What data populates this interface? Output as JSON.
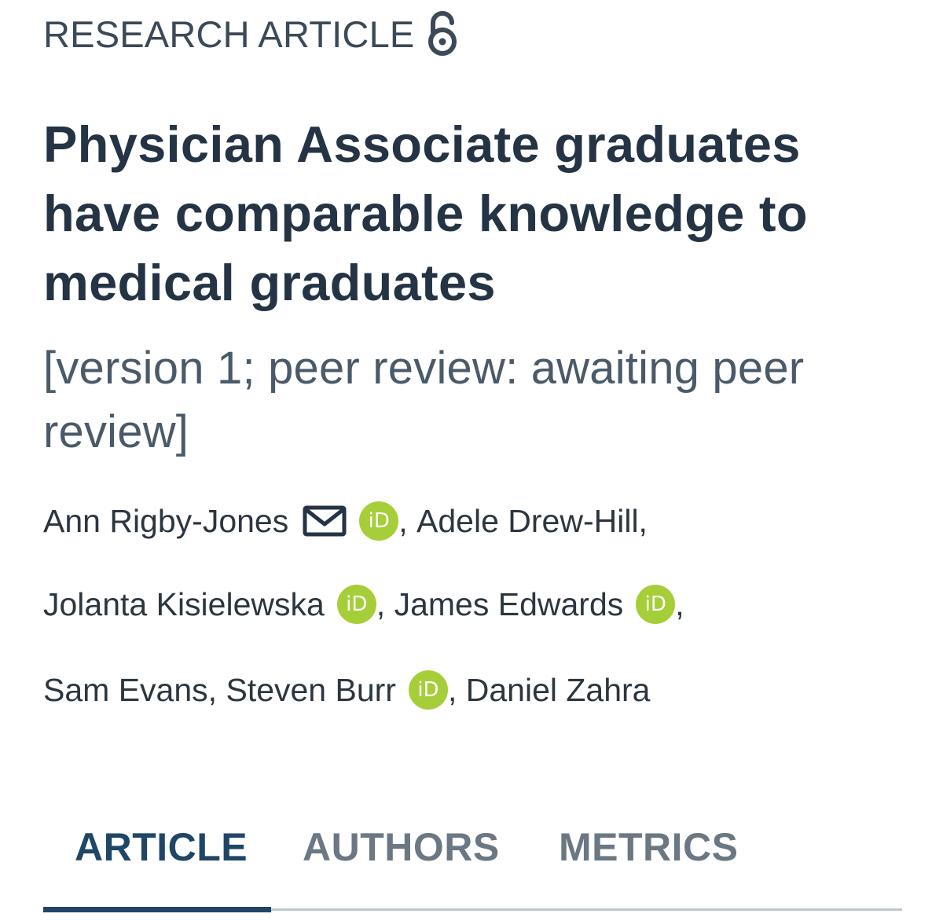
{
  "article_type": "RESEARCH ARTICLE",
  "open_access_icon": "open-access-lock-icon",
  "title": "Physician Associate graduates have comparable knowledge to medical graduates",
  "version_status": "[version 1; peer review: awaiting peer review]",
  "authors": {
    "line1": {
      "a1": "Ann Rigby-Jones",
      "sep1": ", ",
      "a2": "Adele Drew-Hill",
      "sep2": ","
    },
    "line2": {
      "a1": "Jolanta Kisielewska",
      "sep1": ", ",
      "a2": "James Edwards",
      "sep2": ","
    },
    "line3": {
      "a1": "Sam Evans",
      "sep1": ", ",
      "a2": "Steven Burr",
      "sep2": ", ",
      "a3": "Daniel Zahra"
    }
  },
  "orcid_label": "iD",
  "tabs": {
    "article": "ARTICLE",
    "authors": "AUTHORS",
    "metrics": "METRICS",
    "active": "ARTICLE"
  },
  "colors": {
    "title": "#253444",
    "orcid": "#a6ce39",
    "active_tab": "#1f4666",
    "inactive_tab": "#6b7883"
  }
}
